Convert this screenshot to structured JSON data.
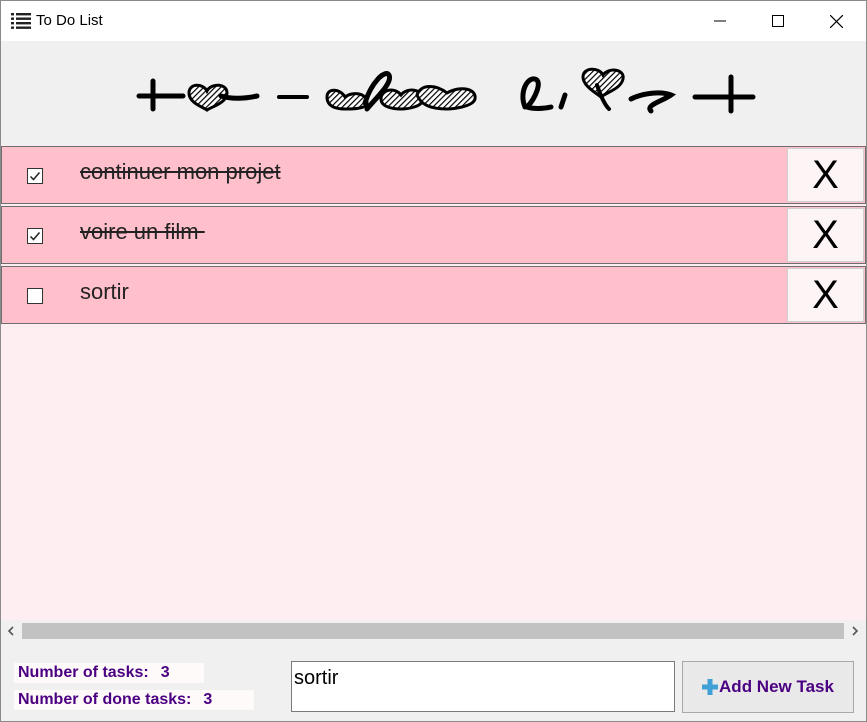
{
  "window": {
    "title": "To Do List",
    "icons": {
      "app": "list-icon",
      "minimize": "minimize-icon",
      "maximize": "maximize-icon",
      "close": "close-icon"
    }
  },
  "header": {
    "logo_text": "to-do list",
    "logo_style": "decorative heart-script logo image"
  },
  "tasks": [
    {
      "label": "continuer mon projet",
      "done": true,
      "delete_label": "X"
    },
    {
      "label": "voire un film ",
      "done": true,
      "delete_label": "X"
    },
    {
      "label": "sortir",
      "done": false,
      "delete_label": "X"
    }
  ],
  "scrollbar": {
    "left_arrow": "‹",
    "right_arrow": "›"
  },
  "footer": {
    "tasks_label": "Number of tasks:",
    "tasks_count": "3",
    "done_label": "Number of done tasks:",
    "done_count": "3",
    "input_value": "sortir",
    "add_button_label": "Add New Task",
    "add_icon": "plus-icon"
  },
  "colors": {
    "task_row": "#ffc0cb",
    "list_background": "#ffeef1",
    "stat_text": "#4b0082",
    "add_icon": "#3fa0d8"
  }
}
